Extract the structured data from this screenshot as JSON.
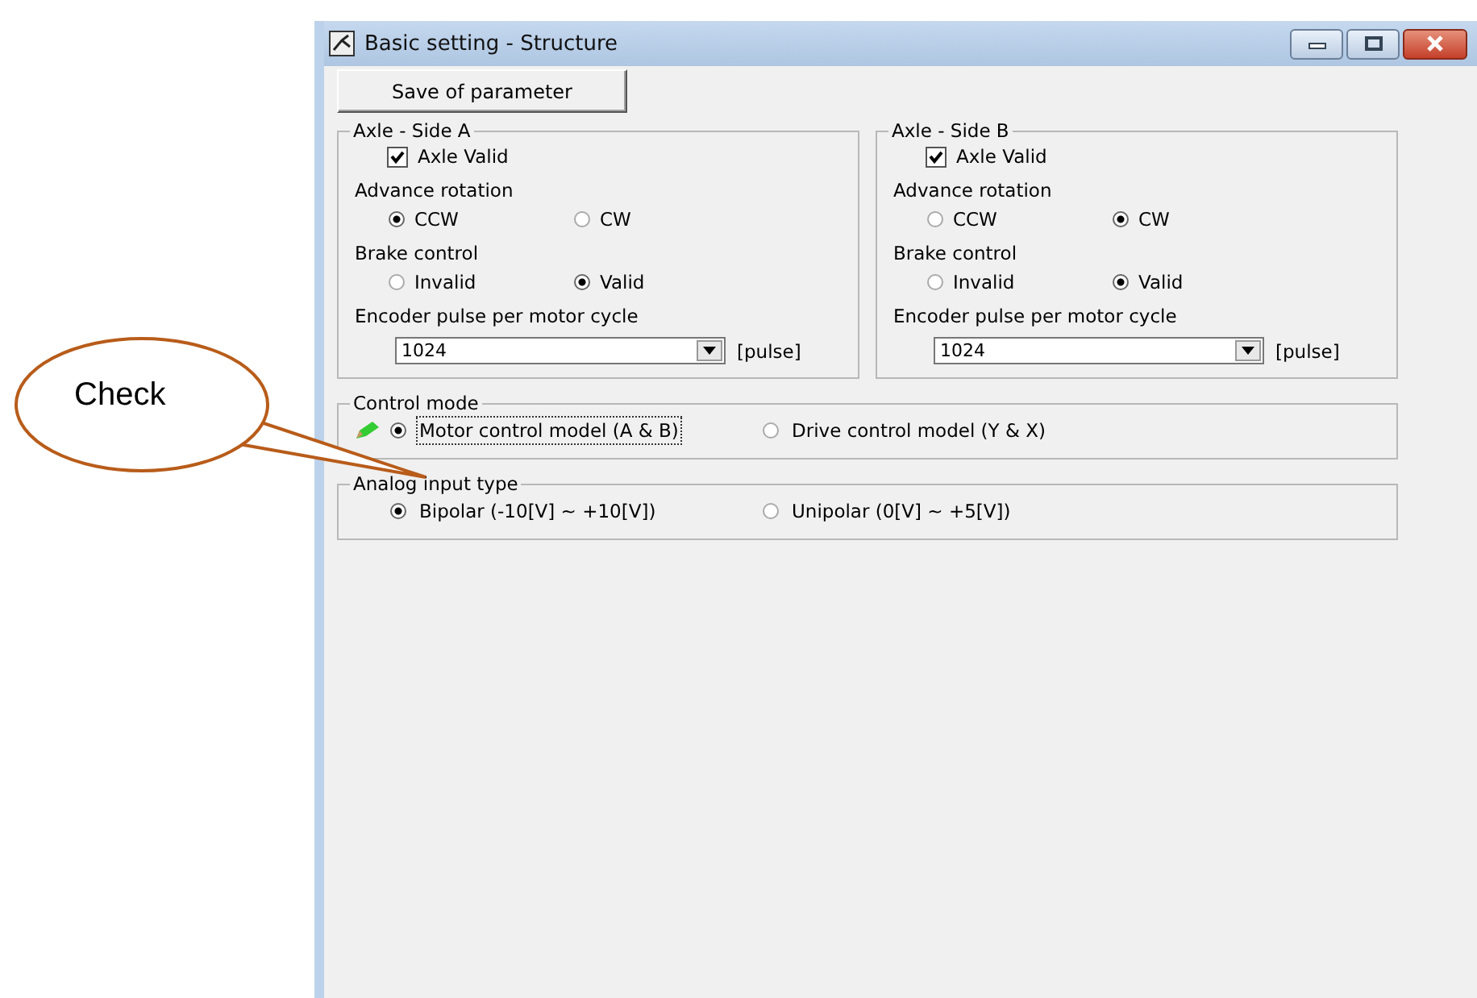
{
  "window": {
    "title": "Basic setting - Structure"
  },
  "save_button": "Save of parameter",
  "axles": [
    {
      "title": "Axle - Side A",
      "axle_valid": {
        "label": "Axle Valid",
        "checked": true
      },
      "advance_rotation": {
        "label": "Advance rotation",
        "options": [
          {
            "label": "CCW",
            "selected": true
          },
          {
            "label": "CW",
            "selected": false
          }
        ]
      },
      "brake_control": {
        "label": "Brake control",
        "options": [
          {
            "label": "Invalid",
            "selected": false
          },
          {
            "label": "Valid",
            "selected": true
          }
        ]
      },
      "encoder": {
        "label": "Encoder pulse per motor cycle",
        "value": "1024",
        "unit": "[pulse]"
      }
    },
    {
      "title": "Axle - Side B",
      "axle_valid": {
        "label": "Axle Valid",
        "checked": true
      },
      "advance_rotation": {
        "label": "Advance rotation",
        "options": [
          {
            "label": "CCW",
            "selected": false
          },
          {
            "label": "CW",
            "selected": true
          }
        ]
      },
      "brake_control": {
        "label": "Brake control",
        "options": [
          {
            "label": "Invalid",
            "selected": false
          },
          {
            "label": "Valid",
            "selected": true
          }
        ]
      },
      "encoder": {
        "label": "Encoder pulse per motor cycle",
        "value": "1024",
        "unit": "[pulse]"
      }
    }
  ],
  "control_mode": {
    "title": "Control mode",
    "options": [
      {
        "label": "Motor control model (A & B)",
        "selected": true,
        "focused": true
      },
      {
        "label": "Drive control model (Y & X)",
        "selected": false,
        "focused": false
      }
    ]
  },
  "analog_input_type": {
    "title": "Analog input type",
    "options": [
      {
        "label": "Bipolar (-10[V] ~ +10[V])",
        "selected": true,
        "focused": false
      },
      {
        "label": "Unipolar (0[V] ~ +5[V])",
        "selected": false,
        "focused": false
      }
    ]
  },
  "callout": {
    "text": "Check"
  }
}
